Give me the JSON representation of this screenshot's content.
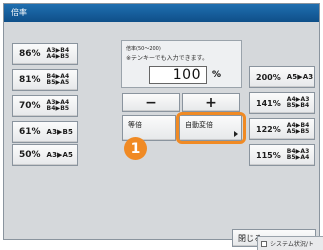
{
  "title": "倍率",
  "presets_left": [
    {
      "pct": "86%",
      "pairs": [
        "A3▶B4",
        "A4▶B5"
      ]
    },
    {
      "pct": "81%",
      "pairs": [
        "B4▶A4",
        "B5▶A5"
      ]
    },
    {
      "pct": "70%",
      "pairs": [
        "A3▶A4",
        "B4▶B5"
      ]
    },
    {
      "pct": "61%",
      "pairs": [
        "A3▶B5"
      ]
    },
    {
      "pct": "50%",
      "pairs": [
        "A3▶A5"
      ]
    }
  ],
  "zoom": {
    "range_label": "倍率(50〜200)",
    "hint": "※テンキーでも入力できます。",
    "value": "100",
    "unit": "%"
  },
  "controls": {
    "minus": "−",
    "plus": "+",
    "same": "等倍",
    "auto": "自動変倍"
  },
  "presets_right": [
    {
      "pct": "200%",
      "pairs": [
        "A5▶A3"
      ]
    },
    {
      "pct": "141%",
      "pairs": [
        "A4▶A3",
        "B5▶B4"
      ]
    },
    {
      "pct": "122%",
      "pairs": [
        "A4▶B4",
        "A5▶B5"
      ]
    },
    {
      "pct": "115%",
      "pairs": [
        "B4▶A3",
        "B5▶A4"
      ]
    }
  ],
  "callout": "1",
  "close": "閉じる",
  "status": "システム状況/ト",
  "colors": {
    "accent": "#f08a24",
    "title_bar": "#0f4f89",
    "panel": "#d5d8db"
  }
}
